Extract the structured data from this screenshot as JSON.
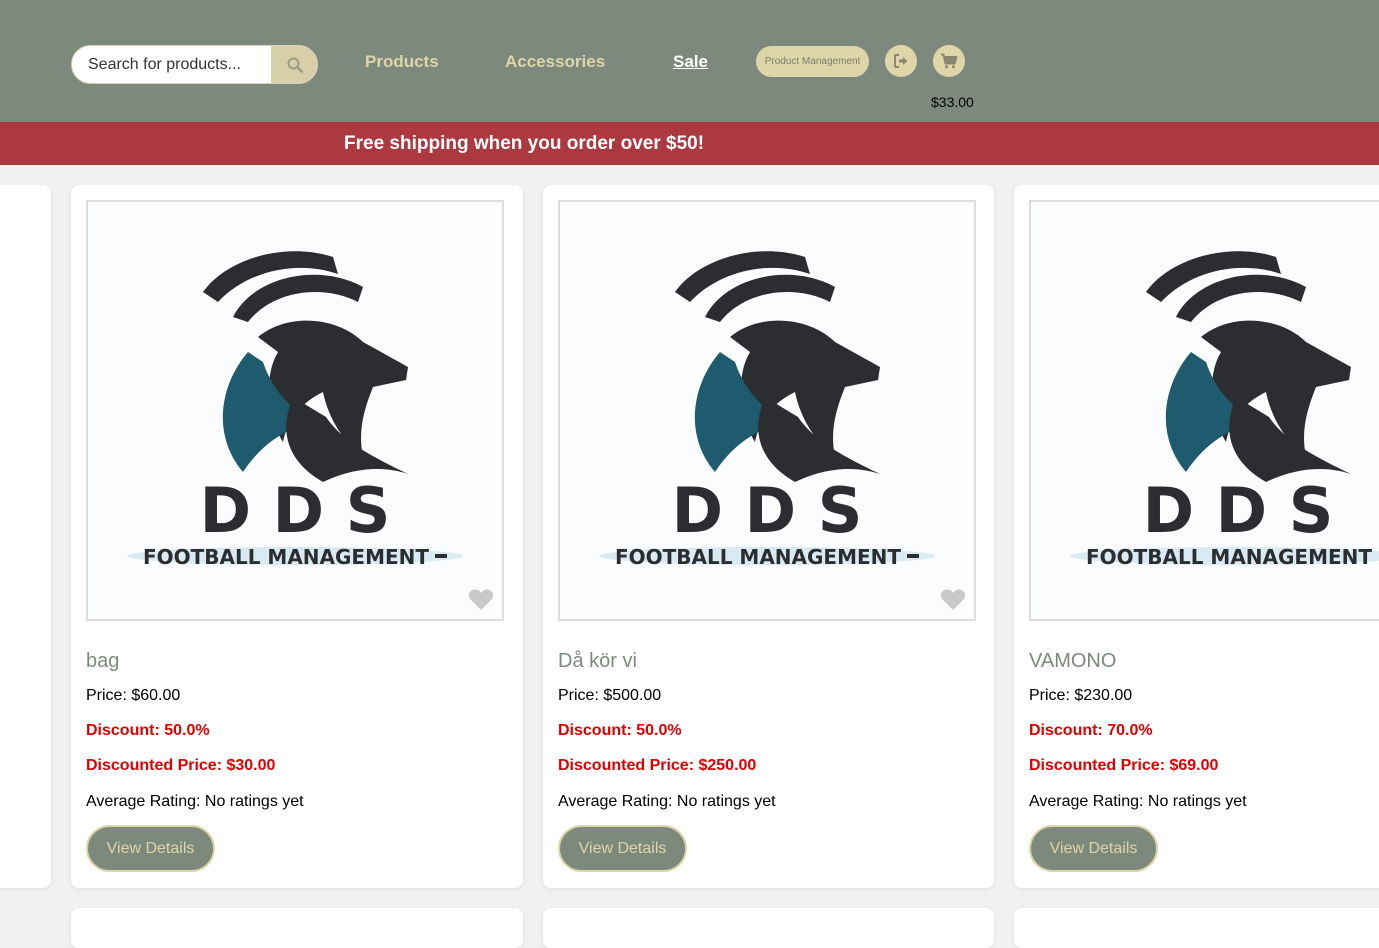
{
  "header": {
    "search": {
      "placeholder": "Search for products..."
    },
    "nav": [
      "Products",
      "Accessories",
      "Sale"
    ],
    "product_management_label": "Product Management",
    "cart_total": "$33.00"
  },
  "banner": {
    "text": "Free shipping when you order over $50!"
  },
  "logo": {
    "title": "D D S",
    "subtitle": "FOOTBALL MANAGEMENT"
  },
  "products": [
    {
      "name": "bag",
      "price": "Price: $60.00",
      "discount": "Discount: 50.0%",
      "discounted_price": "Discounted Price: $30.00",
      "rating": "Average Rating: No ratings yet",
      "button": "View Details"
    },
    {
      "name": "Då kör vi",
      "price": "Price: $500.00",
      "discount": "Discount: 50.0%",
      "discounted_price": "Discounted Price: $250.00",
      "rating": "Average Rating: No ratings yet",
      "button": "View Details"
    },
    {
      "name": "VAMONO",
      "price": "Price: $230.00",
      "discount": "Discount: 70.0%",
      "discounted_price": "Discounted Price: $69.00",
      "rating": "Average Rating: No ratings yet",
      "button": "View Details"
    }
  ],
  "colors": {
    "header": "#7d897c",
    "accent": "#ded6a8",
    "banner": "#ad3940",
    "discount": "#e00000"
  },
  "icons": [
    "search-icon",
    "logout-icon",
    "cart-icon",
    "heart-icon"
  ]
}
